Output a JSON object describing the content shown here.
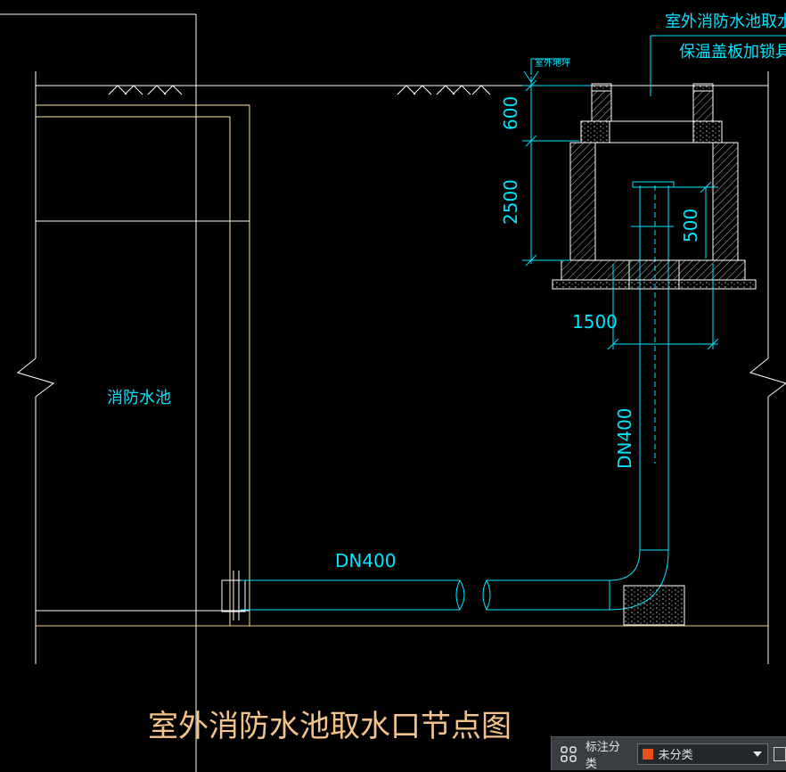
{
  "drawing": {
    "title": "室外消防水池取水口节点图",
    "pool_label": "消防水池",
    "callout_line1": "室外消防水池取水口",
    "callout_line2": "保温盖板加锁具",
    "ground_label": "室外地坪",
    "dim_600": "600",
    "dim_2500": "2500",
    "dim_500": "500",
    "dim_1500": "1500",
    "pipe_vertical": "DN400",
    "pipe_horizontal": "DN400"
  },
  "toolbar": {
    "label": "标注分类",
    "selected": "未分类",
    "swatch_color": "#e8501a",
    "grid_icon": "grid-icon",
    "copy_icon": "copy-icon"
  },
  "colors": {
    "white": "#ffffff",
    "cyan": "#00e5ff",
    "yellow": "#ffe9a8",
    "tan": "#f3c38a",
    "grey": "#9a9a9a"
  }
}
